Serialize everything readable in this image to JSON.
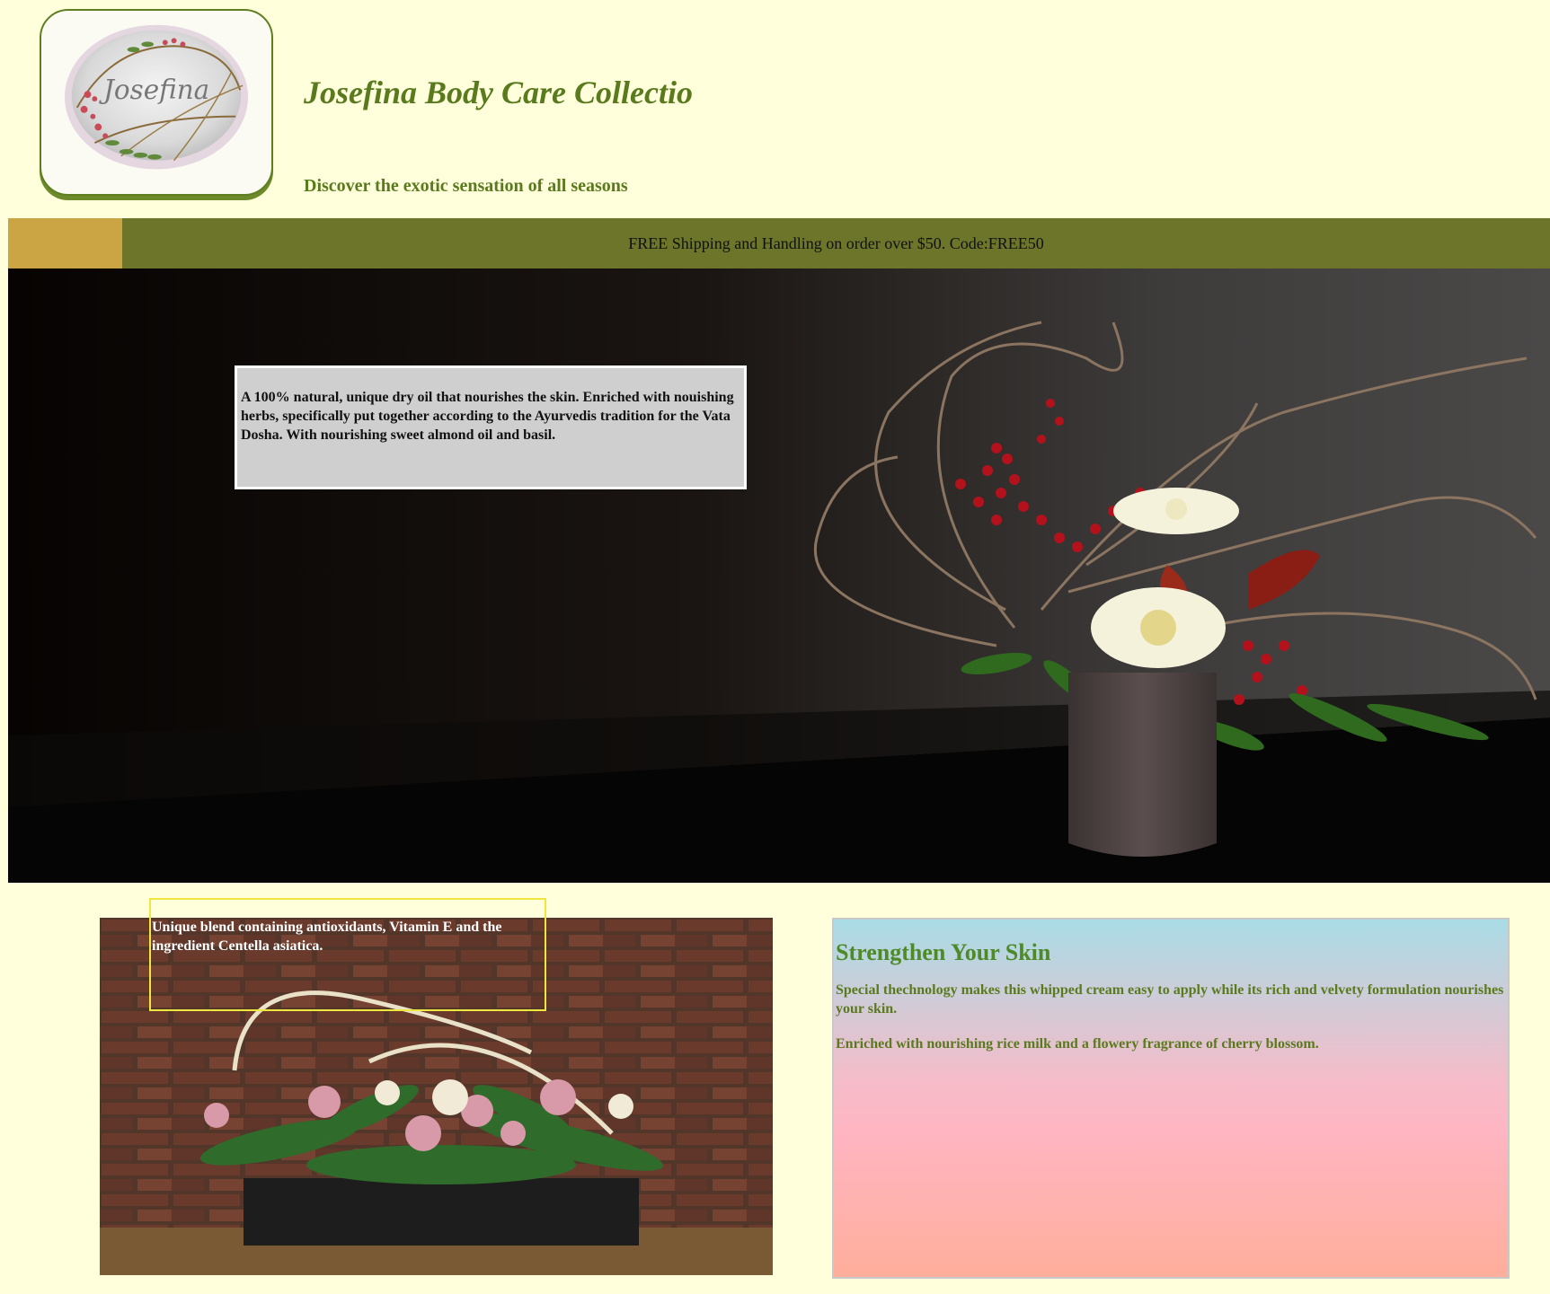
{
  "header": {
    "logo_text": "Josefina",
    "title": "Josefina Body Care Collectio",
    "tagline": "Discover the exotic sensation of all seasons"
  },
  "promo": {
    "text": "FREE Shipping and Handling on order over $50. Code:FREE50"
  },
  "hero": {
    "caption": "A 100% natural, unique dry oil that nourishes the skin. Enriched with nouishing herbs, specifically put together according to the Ayurvedis tradition for the Vata Dosha. With nourishing sweet almond oil and basil."
  },
  "product_photo": {
    "caption": "Unique blend containing antioxidants, Vitamin E and the ingredient Centella asiatica."
  },
  "info_panel": {
    "heading": "Strengthen Your Skin",
    "paragraph_1": "Special thechnology makes this whipped cream easy to apply while its rich and velvety formulation nourishes your skin.",
    "paragraph_2": "Enriched with nourishing rice milk and a flowery fragrance of cherry blossom."
  },
  "colors": {
    "page_background": "#ffffdc",
    "brand_green": "#5a7a1e",
    "promo_bar": "#6c7529",
    "promo_accent": "#cba544",
    "caption_box": "#cfcfcf",
    "caption_outline": "#f0e640"
  }
}
